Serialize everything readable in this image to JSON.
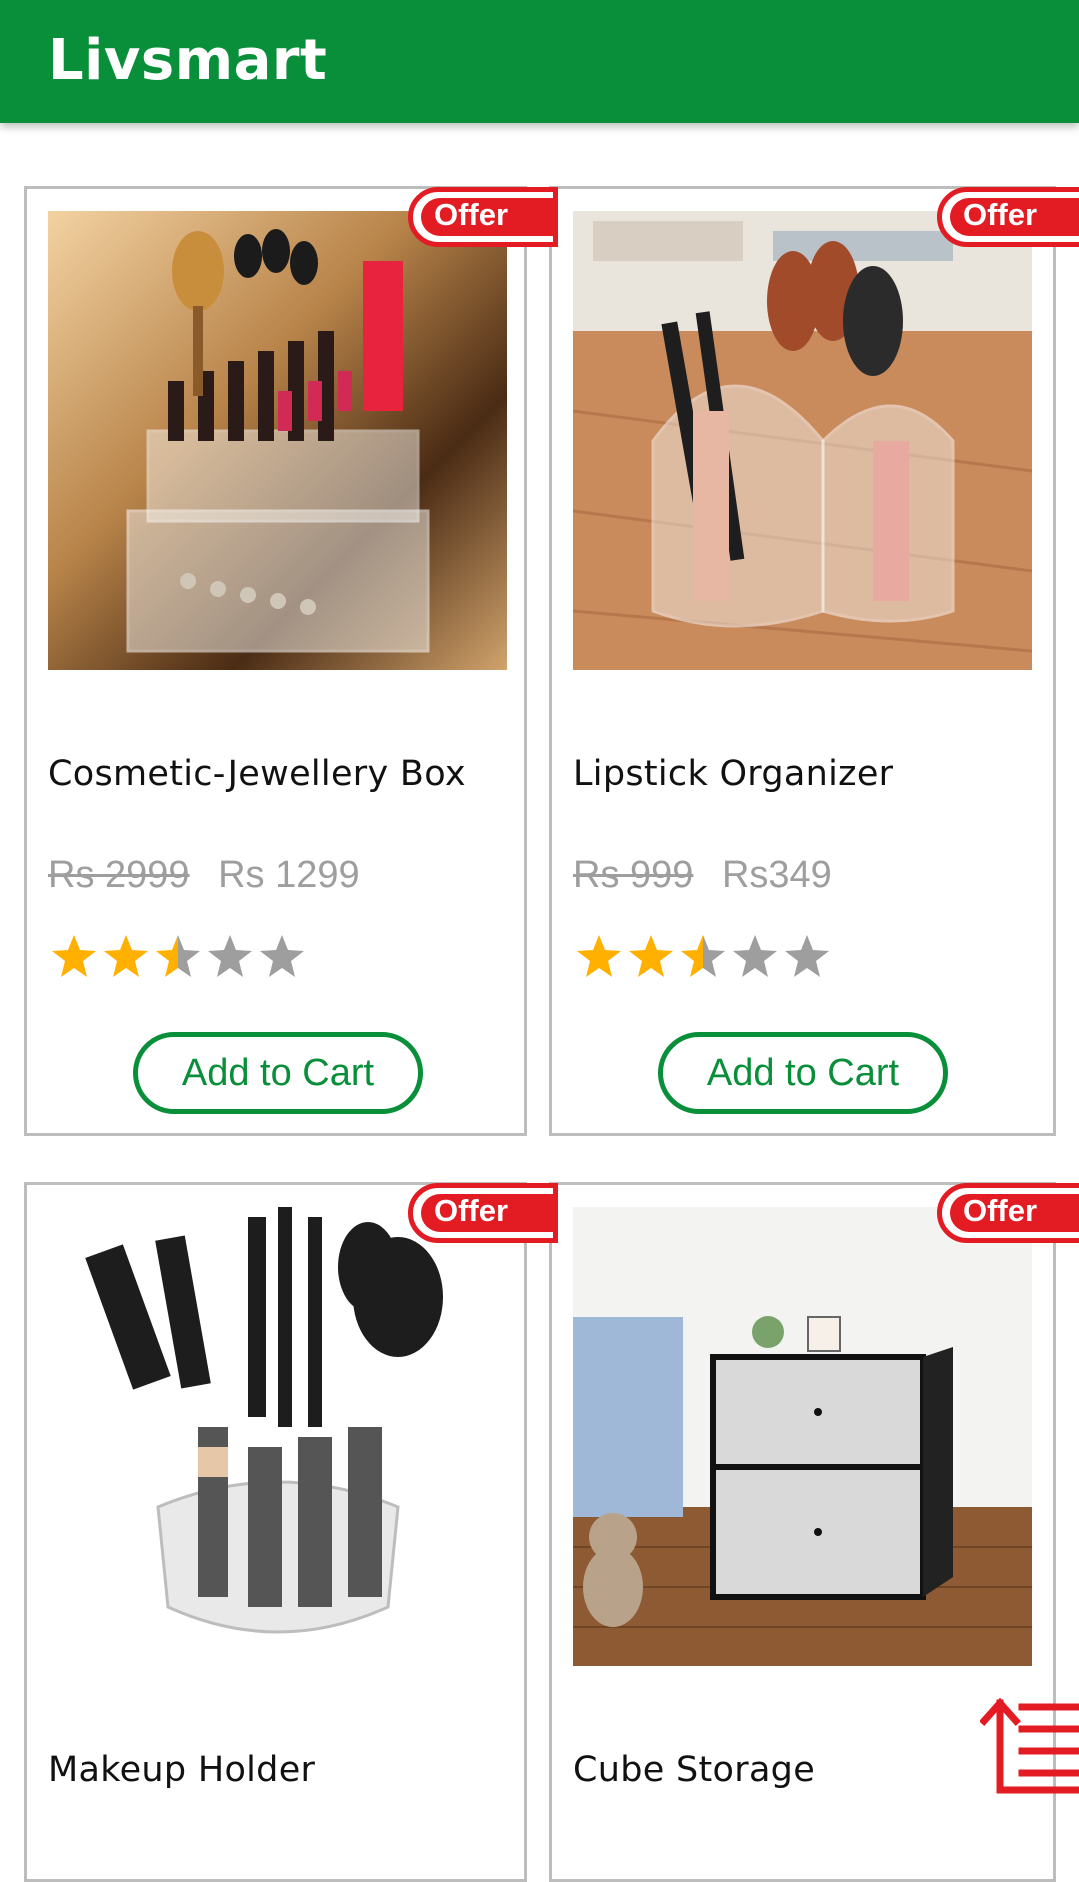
{
  "app": {
    "title": "Livsmart"
  },
  "products": [
    {
      "name": "Cosmetic-Jewellery Box",
      "old_price": "Rs 2999",
      "price": "Rs 1299",
      "badge": "Offer",
      "rating": 2.5,
      "button": "Add to Cart"
    },
    {
      "name": "Lipstick Organizer",
      "old_price": "Rs 999",
      "price": "Rs349",
      "badge": "Offer",
      "rating": 2.5,
      "button": "Add to Cart"
    },
    {
      "name": "Makeup Holder",
      "badge": "Offer"
    },
    {
      "name": "Cube Storage",
      "badge": "Offer"
    }
  ],
  "colors": {
    "brand": "#098f3a",
    "offer": "#e31b23",
    "star": "#ffb000",
    "star_empty": "#9e9e9e"
  }
}
